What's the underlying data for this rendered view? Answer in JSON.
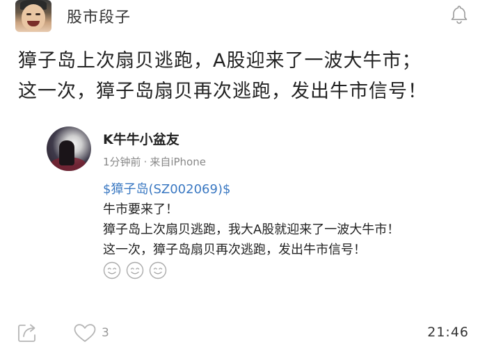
{
  "header": {
    "channel_name": "股市段子"
  },
  "post": {
    "lines": [
      "獐子岛上次扇贝逃跑，A股迎来了一波大牛市；",
      "这一次，獐子岛扇贝再次逃跑，发出牛市信号！"
    ]
  },
  "quoted": {
    "author": "K牛牛小盆友",
    "time_ago": "1分钟前",
    "source_sep": "·",
    "source": "来自iPhone",
    "stock_link": "$獐子岛(SZ002069)$",
    "lines": [
      "牛市要来了！",
      "獐子岛上次扇贝逃跑，我大A股就迎来了一波大牛市！",
      "这一次，獐子岛扇贝再次逃跑，发出牛市信号！"
    ],
    "emoji": [
      "smile-icon",
      "smile-icon",
      "smile-icon"
    ]
  },
  "footer": {
    "like_count": "3",
    "time": "21:46"
  },
  "colors": {
    "link": "#3a78c2",
    "meta": "#888888",
    "icon": "#b5b5b5"
  }
}
